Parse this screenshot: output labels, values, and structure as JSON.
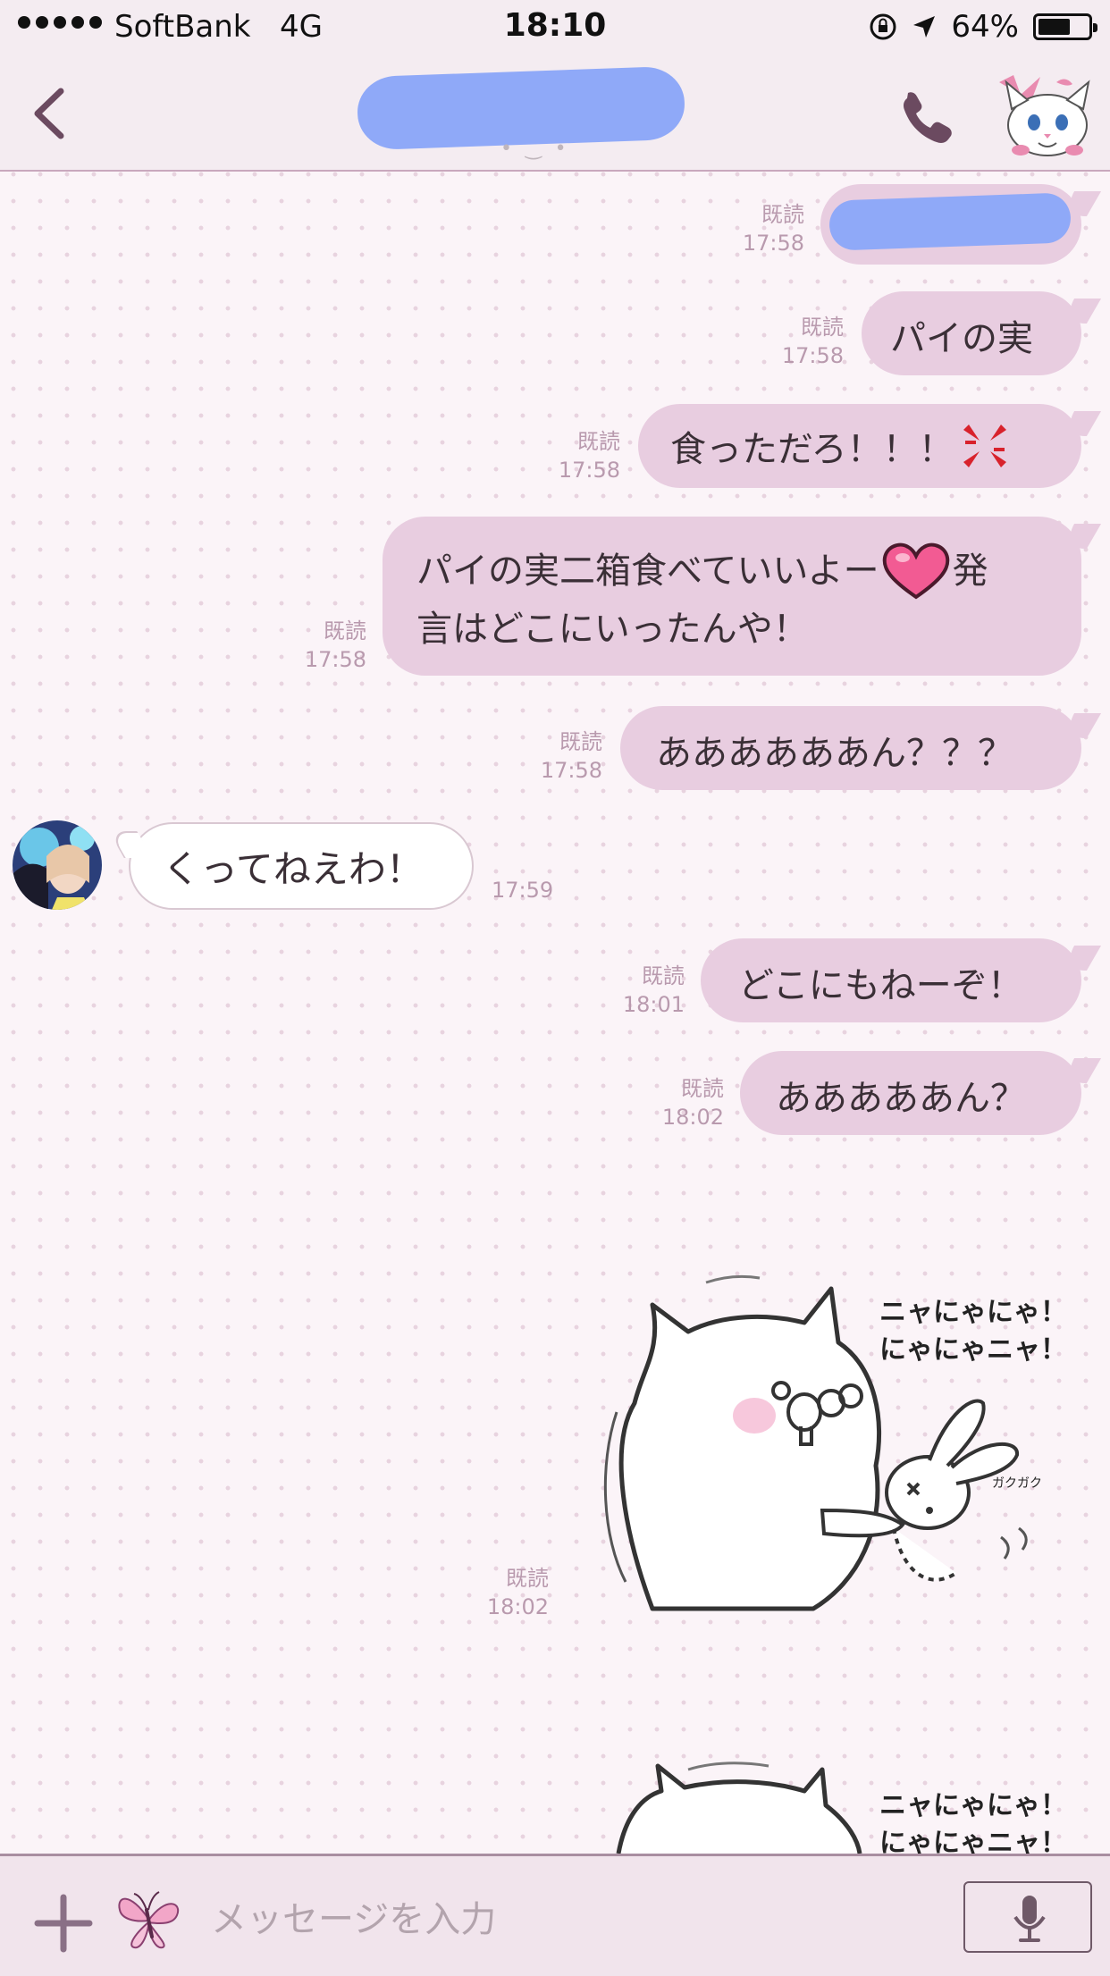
{
  "status_bar": {
    "carrier": "SoftBank",
    "network": "4G",
    "time": "18:10",
    "battery": "64%",
    "battery_level": 0.64
  },
  "header": {
    "icons": [
      "back-chevron-icon",
      "phone-icon",
      "cat-avatar-icon"
    ]
  },
  "messages": [
    {
      "side": "out",
      "read": "既読",
      "time": "17:58",
      "text": "",
      "redacted": true
    },
    {
      "side": "out",
      "read": "既読",
      "time": "17:58",
      "text": "パイの実"
    },
    {
      "side": "out",
      "read": "既読",
      "time": "17:58",
      "text": "食っただろ！！！",
      "emoji": "anger-icon"
    },
    {
      "side": "out",
      "read": "既読",
      "time": "17:58",
      "line1": "パイの実二箱食べていいよー",
      "line1_end": "発",
      "line2": "言はどこにいったんや！",
      "emoji": "heart-icon"
    },
    {
      "side": "out",
      "read": "既読",
      "time": "17:58",
      "text": "ああああああん？？？"
    },
    {
      "side": "in",
      "time": "17:59",
      "text": "くってねえわ！"
    },
    {
      "side": "out",
      "read": "既読",
      "time": "18:01",
      "text": "どこにもねーぞ！"
    },
    {
      "side": "out",
      "read": "既読",
      "time": "18:02",
      "text": "あああああん？"
    }
  ],
  "stickers": [
    {
      "read": "既読",
      "time": "18:02",
      "caption_line1": "ニャにゃにゃ！",
      "caption_line2": "にゃにゃニャ！",
      "sfx": "ガクガク"
    },
    {
      "caption_line1": "ニャにゃにゃ！",
      "caption_line2": "にゃにゃニャ！"
    }
  ],
  "input": {
    "placeholder": "メッセージを入力",
    "icons": [
      "plus-icon",
      "butterfly-sticker-icon",
      "microphone-icon"
    ]
  },
  "colors": {
    "bubble_out": "#e8cde0",
    "bubble_in": "#ffffff",
    "accent": "#6b4a60",
    "redaction": "#8fa9f8"
  }
}
